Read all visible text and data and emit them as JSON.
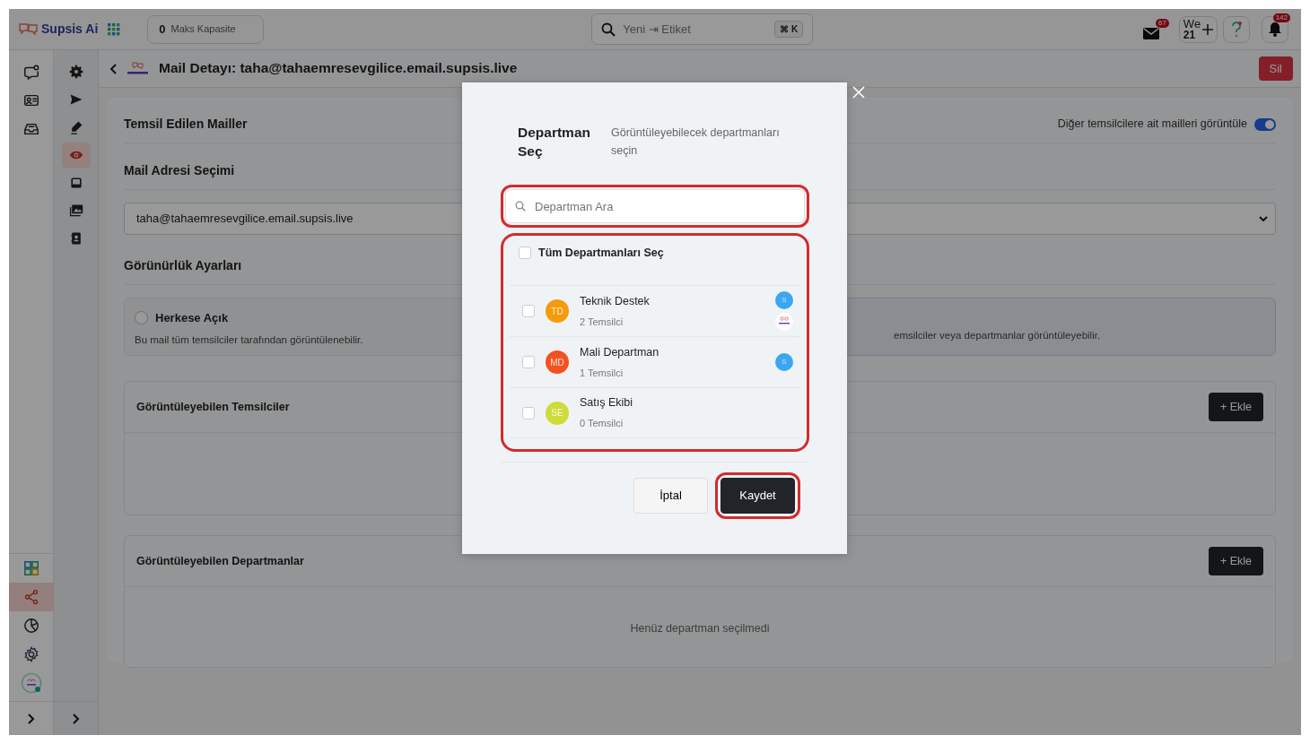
{
  "topbar": {
    "brand": "Supsis Ai",
    "capacity": {
      "value": "0",
      "label": "Maks Kapasite"
    },
    "search": {
      "placeholder": "Yeni ⇥ Etiket",
      "shortcut": "⌘ K"
    },
    "mail_badge": "67",
    "date": {
      "day_name": "We",
      "day": "21"
    },
    "notification_badge": "142"
  },
  "rail": {
    "top": [
      {
        "kind": "chat",
        "selected": false
      },
      {
        "kind": "id-card",
        "selected": false
      },
      {
        "kind": "inbox",
        "selected": false
      }
    ],
    "bottom": [
      {
        "kind": "apps",
        "selected": false
      },
      {
        "kind": "share",
        "selected": true
      },
      {
        "kind": "pie",
        "selected": false
      },
      {
        "kind": "gear",
        "selected": false
      },
      {
        "kind": "avatar",
        "selected": false
      }
    ]
  },
  "subrail": [
    {
      "kind": "gear",
      "selected": false
    },
    {
      "kind": "send",
      "selected": false
    },
    {
      "kind": "pen",
      "selected": false
    },
    {
      "kind": "eye",
      "selected": true
    },
    {
      "kind": "tray",
      "selected": false
    },
    {
      "kind": "images",
      "selected": false
    },
    {
      "kind": "contact",
      "selected": false
    }
  ],
  "page": {
    "title": "Mail Detayı: taha@tahaemresevgilice.email.supsis.live",
    "delete_button": "Sil"
  },
  "represented": {
    "title": "Temsil Edilen Mailler",
    "toggle": {
      "label": "Diğer temsilcilere ait mailleri görüntüle",
      "on": true
    }
  },
  "mail_select": {
    "title": "Mail Adresi Seçimi",
    "value": "taha@tahaemresevgilice.email.supsis.live"
  },
  "visibility": {
    "title": "Görünürlük Ayarları",
    "options": [
      {
        "label": "Herkese Açık",
        "description": "Bu mail tüm temsilciler tarafından görüntülenebilir.",
        "selected": false
      },
      {
        "description": "emsilciler veya departmanlar görüntüleyebilir.",
        "selected": true
      }
    ]
  },
  "panels": [
    {
      "title": "Görüntüleyebilen Temsilciler",
      "add_button": "+ Ekle"
    },
    {
      "title": "Görüntüleyebilen Departmanlar",
      "add_button": "+ Ekle",
      "empty_text": "Henüz departman seçilmedi"
    }
  ],
  "modal": {
    "title": "Departman Seç",
    "subtitle": "Görüntüleyebilecek departmanları seçin",
    "search": {
      "placeholder": "Departman Ara"
    },
    "select_all": {
      "label": "Tüm Departmanları Seç",
      "checked": false
    },
    "departments": [
      {
        "initials": "TD",
        "name": "Teknik Destek",
        "count": "2 Temsilci",
        "color": "#f59a0b",
        "checked": false,
        "members": [
          {
            "kind": "letter",
            "text": "S"
          },
          {
            "kind": "logo"
          }
        ]
      },
      {
        "initials": "MD",
        "name": "Mali Departman",
        "count": "1 Temsilci",
        "color": "#f4511e",
        "checked": false,
        "members": [
          {
            "kind": "letter",
            "text": "S"
          }
        ]
      },
      {
        "initials": "SE",
        "name": "Satış Ekibi",
        "count": "0 Temsilci",
        "color": "#cddc39",
        "checked": false
      }
    ],
    "cancel_button": "İptal",
    "save_button": "Kaydet"
  }
}
